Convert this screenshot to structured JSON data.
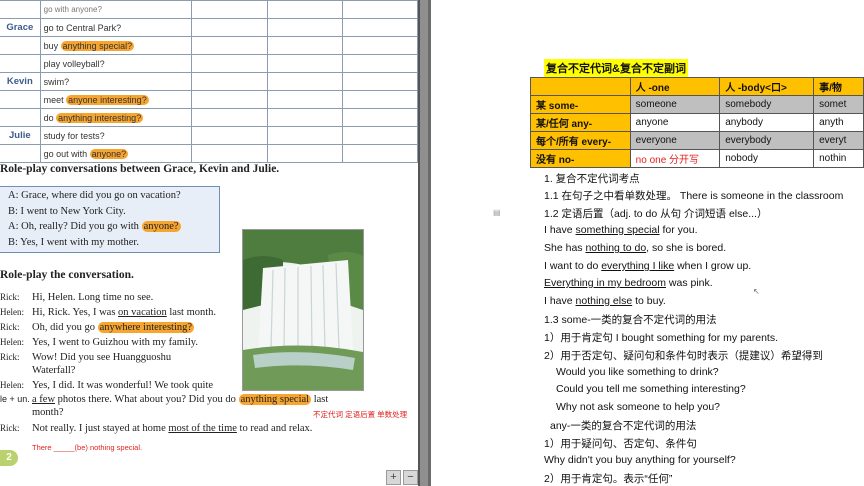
{
  "left_page": {
    "table": [
      {
        "name": "",
        "activity": "go with anyone?",
        "hl": ""
      },
      {
        "name": "Grace",
        "activity": "go to Central Park?",
        "hl": ""
      },
      {
        "name": "",
        "activity": "buy anything special?",
        "hl": "anything special?"
      },
      {
        "name": "",
        "activity": "play volleyball?",
        "hl": ""
      },
      {
        "name": "Kevin",
        "activity": "swim?",
        "hl": ""
      },
      {
        "name": "",
        "activity": "meet anyone interesting?",
        "hl": "anyone interesting?"
      },
      {
        "name": "",
        "activity": "do anything interesting?",
        "hl": "anything interesting?"
      },
      {
        "name": "Julie",
        "activity": "study for tests?",
        "hl": ""
      },
      {
        "name": "",
        "activity": "go out with anyone?",
        "hl": "anyone?"
      }
    ],
    "heading1": "Role-play conversations between Grace, Kevin and Julie.",
    "dialog": {
      "l1": "A: Grace, where did you go on vacation?",
      "l2": "B: I went to New York City.",
      "l3_pre": "A: Oh, really? Did you go with ",
      "l3_hl": "anyone?",
      "l4": "B: Yes, I went with my mother."
    },
    "heading2": "Role-play the conversation.",
    "conversation": {
      "s1": "Rick:",
      "t1": "Hi, Helen. Long time no see.",
      "s2": "Helen:",
      "t2a": "Hi, Rick. Yes, I was ",
      "t2u": "on vacation",
      "t2b": " last month.",
      "s3": "Rick:",
      "t3a": "Oh, did you go ",
      "t3h": "anywhere interesting?",
      "s4": "Helen:",
      "t4": "Yes, I went to Guizhou with my family.",
      "s5": "Rick:",
      "t5": "Wow! Did you see Huangguoshu",
      "t5b": "Waterfall?",
      "s6": "Helen:",
      "t6": "Yes, I did. It was wonderful! We took quite",
      "s7": "le + un.",
      "t7a": "a few",
      "t7b": " photos there. What about you? Did you do ",
      "t7h": "anything special",
      "t7c": " last",
      "t8": "month?",
      "note": "不定代词 定语后置 单数处理",
      "s9": "Rick:",
      "t9a": "Not really. I just stayed at home ",
      "t9u": "most of the time",
      "t9b": " to read and relax.",
      "t10": "There _____(be) nothing special.",
      "badge": "2"
    },
    "zoom_plus": "+",
    "zoom_minus": "−"
  },
  "right_page": {
    "title": "复合不定代词&复合不定副词",
    "table": {
      "headers": [
        "",
        "人 -one",
        "人 -body<口>",
        "事/物"
      ],
      "rows": [
        [
          "某 some-",
          "someone",
          "somebody",
          "somet"
        ],
        [
          "某/任何 any-",
          "anyone",
          "anybody",
          "anyth"
        ],
        [
          "每个/所有 every-",
          "everyone",
          "everybody",
          "everyt"
        ],
        [
          "没有 no-",
          "no one 分开写",
          "nobody",
          "nothin"
        ]
      ]
    },
    "lines": {
      "l1": "1.  复合不定代词考点",
      "l2": "1.1 在句子之中看单数处理。 There is someone in the classroom",
      "l3": "1.2 定语后置（adj.     to do       从句   介词短语     else...）",
      "l4a": "I have ",
      "l4u": "something special",
      " l4b": " for you.",
      "l5a": "She has ",
      "l5u": "nothing to do",
      "l5b": ", so she is bored.",
      "l6a": "I want to do ",
      "l6u": "everything I like",
      "l6b": " when I grow up.",
      "l7u": "Everything in my bedroom",
      "l7b": " was pink.",
      "l8a": "I have ",
      "l8u": "nothing else",
      "l8b": " to buy.",
      "l9": "1.3 some-一类的复合不定代词的用法",
      "l10": "1）用于肯定句  I bought something for my parents.",
      "l11": "2）用于否定句、疑问句和条件句时表示（提建议）希望得到",
      "l12": "Would you like something to drink?",
      "l13": "Could you tell me something interesting?",
      "l14": "Why not ask someone to help you?",
      "l15": "any-一类的复合不定代词的用法",
      "l16": "1）用于疑问句、否定句、条件句",
      "l17": "Why didn't you buy anything for yourself?",
      "l18": "2）用于肯定句。表示“任何”"
    }
  }
}
